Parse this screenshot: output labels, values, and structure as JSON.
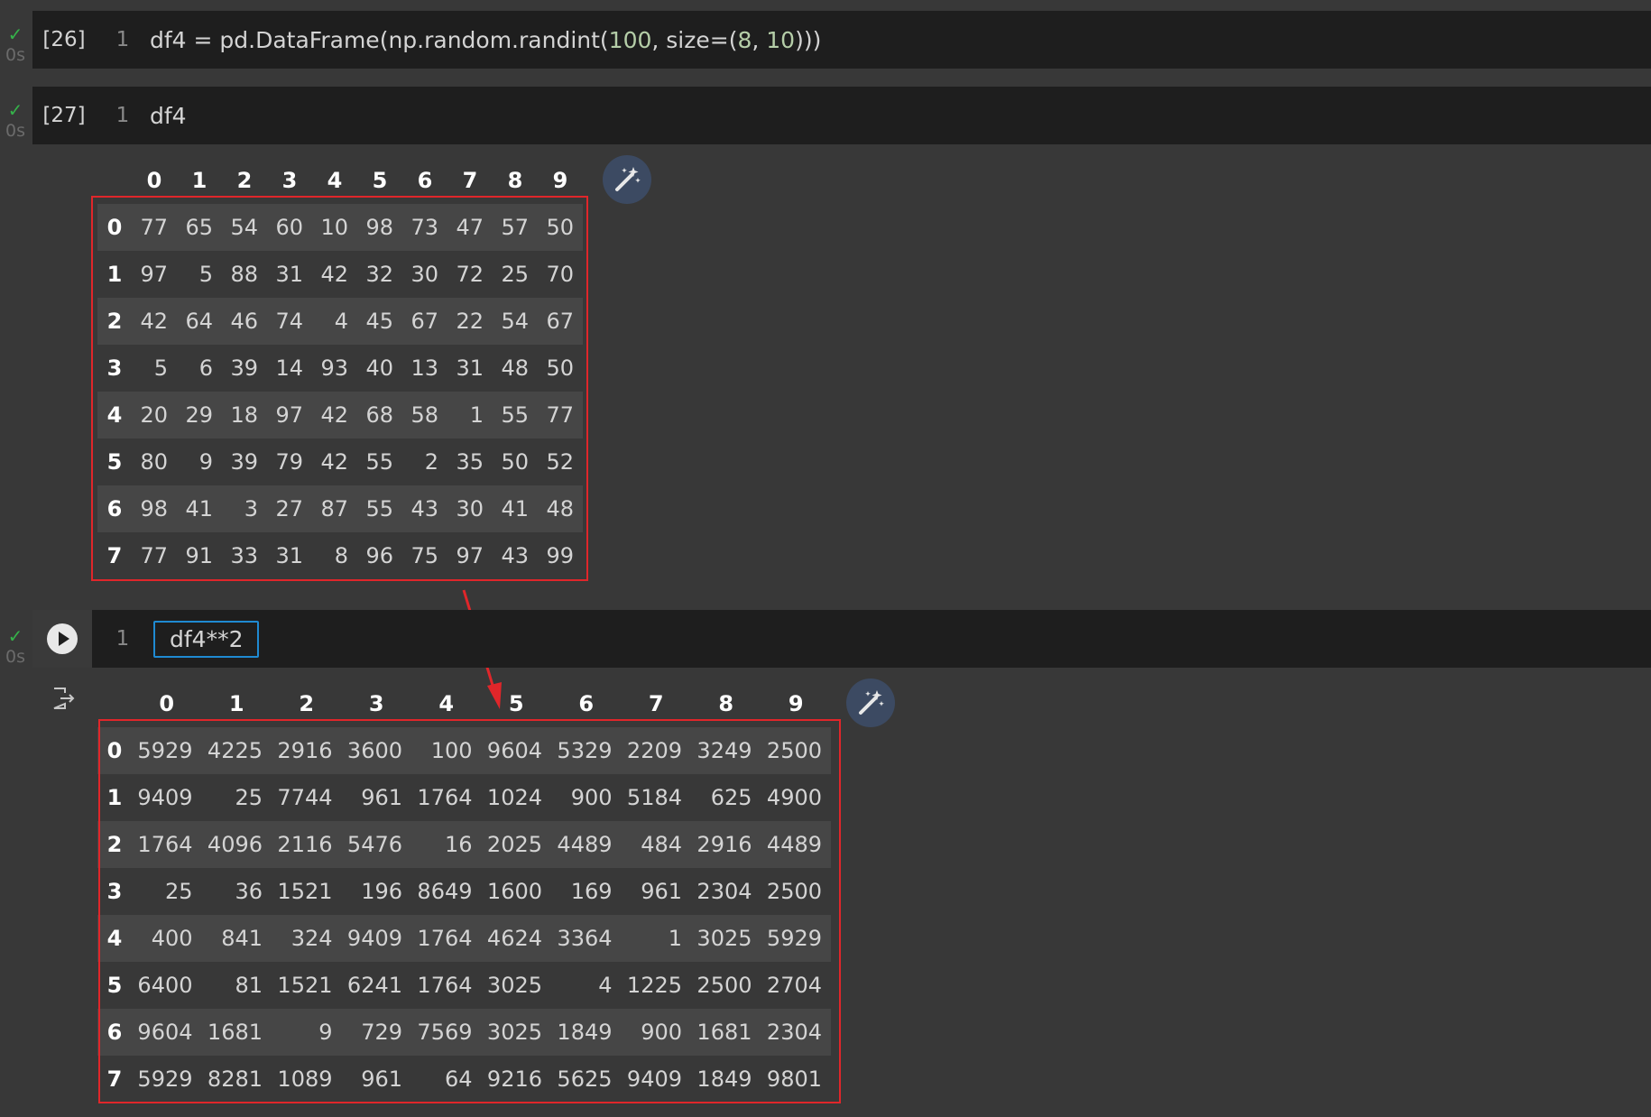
{
  "cells": [
    {
      "exec_count": "[26]",
      "line_no": "1",
      "status_time": "0s",
      "code_parts": {
        "a": "df4 = pd.DataFrame(np.random.randint(",
        "n1": "100",
        "b": ", size=(",
        "n2": "8",
        "c": ", ",
        "n3": "10",
        "d": ")))"
      }
    },
    {
      "exec_count": "[27]",
      "line_no": "1",
      "status_time": "0s",
      "code": "df4"
    },
    {
      "exec_count": "",
      "line_no": "1",
      "status_time": "0s",
      "code": "df4**2"
    }
  ],
  "columns": [
    "0",
    "1",
    "2",
    "3",
    "4",
    "5",
    "6",
    "7",
    "8",
    "9"
  ],
  "df4": {
    "index": [
      "0",
      "1",
      "2",
      "3",
      "4",
      "5",
      "6",
      "7"
    ],
    "rows": [
      [
        77,
        65,
        54,
        60,
        10,
        98,
        73,
        47,
        57,
        50
      ],
      [
        97,
        5,
        88,
        31,
        42,
        32,
        30,
        72,
        25,
        70
      ],
      [
        42,
        64,
        46,
        74,
        4,
        45,
        67,
        22,
        54,
        67
      ],
      [
        5,
        6,
        39,
        14,
        93,
        40,
        13,
        31,
        48,
        50
      ],
      [
        20,
        29,
        18,
        97,
        42,
        68,
        58,
        1,
        55,
        77
      ],
      [
        80,
        9,
        39,
        79,
        42,
        55,
        2,
        35,
        50,
        52
      ],
      [
        98,
        41,
        3,
        27,
        87,
        55,
        43,
        30,
        41,
        48
      ],
      [
        77,
        91,
        33,
        31,
        8,
        96,
        75,
        97,
        43,
        99
      ]
    ]
  },
  "df4_squared": {
    "index": [
      "0",
      "1",
      "2",
      "3",
      "4",
      "5",
      "6",
      "7"
    ],
    "rows": [
      [
        5929,
        4225,
        2916,
        3600,
        100,
        9604,
        5329,
        2209,
        3249,
        2500
      ],
      [
        9409,
        25,
        7744,
        961,
        1764,
        1024,
        900,
        5184,
        625,
        4900
      ],
      [
        1764,
        4096,
        2116,
        5476,
        16,
        2025,
        4489,
        484,
        2916,
        4489
      ],
      [
        25,
        36,
        1521,
        196,
        8649,
        1600,
        169,
        961,
        2304,
        2500
      ],
      [
        400,
        841,
        324,
        9409,
        1764,
        4624,
        3364,
        1,
        3025,
        5929
      ],
      [
        6400,
        81,
        1521,
        6241,
        1764,
        3025,
        4,
        1225,
        2500,
        2704
      ],
      [
        9604,
        1681,
        9,
        729,
        7569,
        3025,
        1849,
        900,
        1681,
        2304
      ],
      [
        5929,
        8281,
        1089,
        961,
        64,
        9216,
        5625,
        9409,
        1849,
        9801
      ]
    ]
  },
  "colors": {
    "accent": "#1f8ad2",
    "highlight": "#e0262a",
    "success": "#35b24a"
  },
  "icons": [
    "check-icon",
    "play-icon",
    "magic-wand-icon",
    "output-icon"
  ]
}
